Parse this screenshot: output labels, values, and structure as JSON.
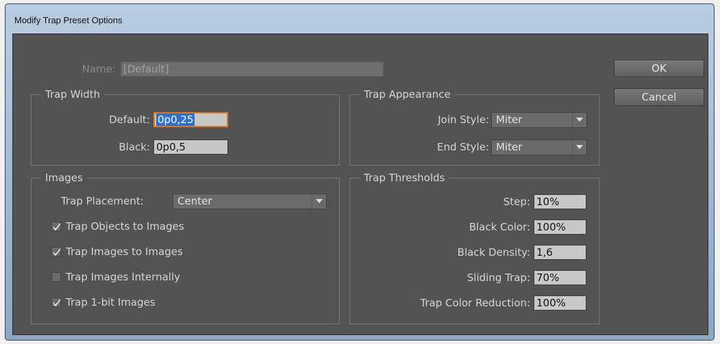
{
  "window": {
    "title": "Modify Trap Preset Options"
  },
  "name_row": {
    "label": "Name:",
    "value": "[Default]"
  },
  "buttons": {
    "ok": "OK",
    "cancel": "Cancel"
  },
  "trap_width": {
    "title": "Trap Width",
    "default_label": "Default:",
    "default_value": "0p0,25",
    "black_label": "Black:",
    "black_value": "0p0,5"
  },
  "images": {
    "title": "Images",
    "placement_label": "Trap Placement:",
    "placement_value": "Center",
    "checkboxes": [
      {
        "label": "Trap Objects to Images",
        "checked": true
      },
      {
        "label": "Trap Images to Images",
        "checked": true
      },
      {
        "label": "Trap Images Internally",
        "checked": false
      },
      {
        "label": "Trap 1-bit Images",
        "checked": true
      }
    ]
  },
  "trap_appearance": {
    "title": "Trap Appearance",
    "join_label": "Join Style:",
    "join_value": "Miter",
    "end_label": "End Style:",
    "end_value": "Miter"
  },
  "trap_thresholds": {
    "title": "Trap Thresholds",
    "rows": [
      {
        "label": "Step:",
        "value": "10%"
      },
      {
        "label": "Black Color:",
        "value": "100%"
      },
      {
        "label": "Black Density:",
        "value": "1,6"
      },
      {
        "label": "Sliding Trap:",
        "value": "70%"
      },
      {
        "label": "Trap Color Reduction:",
        "value": "100%"
      }
    ]
  }
}
